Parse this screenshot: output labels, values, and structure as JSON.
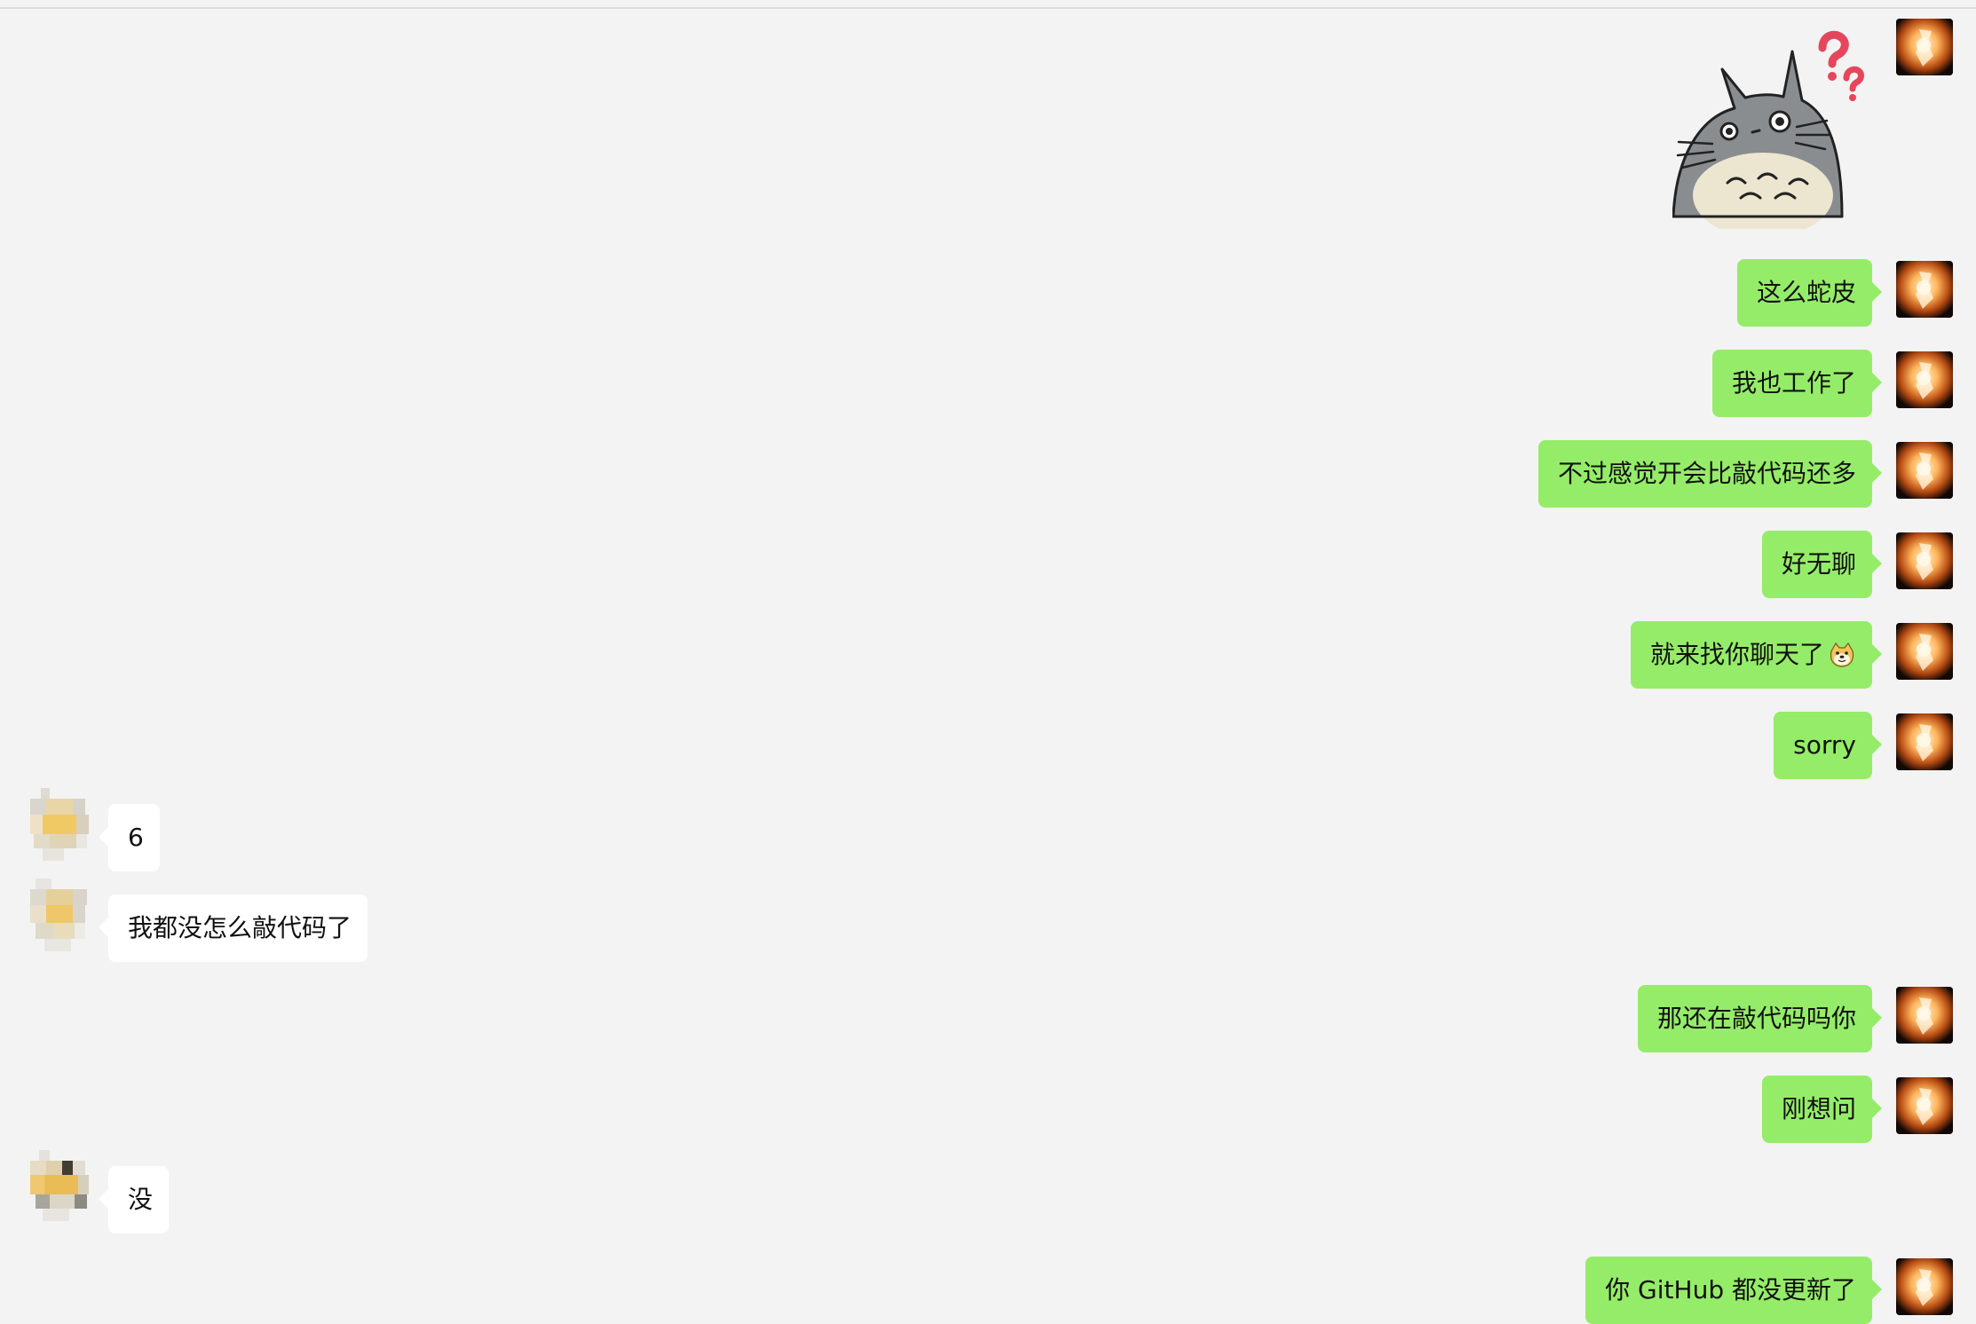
{
  "chat": {
    "sticker": {
      "icon": "totoro-confused-sticker-icon"
    },
    "messages": [
      {
        "text": "这么蛇皮"
      },
      {
        "text": "我也工作了"
      },
      {
        "text": "不过感觉开会比敲代码还多"
      },
      {
        "text": "好无聊"
      },
      {
        "text": "就来找你聊天了",
        "emoji_icon": "doge-emoji-icon"
      },
      {
        "text": "sorry"
      },
      {
        "text": "6"
      },
      {
        "text": "我都没怎么敲代码了"
      },
      {
        "text": "那还在敲代码吗你"
      },
      {
        "text": "刚想问"
      },
      {
        "text": "没"
      },
      {
        "text": "你 GitHub 都没更新了"
      }
    ]
  },
  "colors": {
    "background": "#f3f3f3",
    "outgoing_bubble": "#95ec69",
    "incoming_bubble": "#ffffff",
    "sticker_accent": "#e5465c"
  }
}
